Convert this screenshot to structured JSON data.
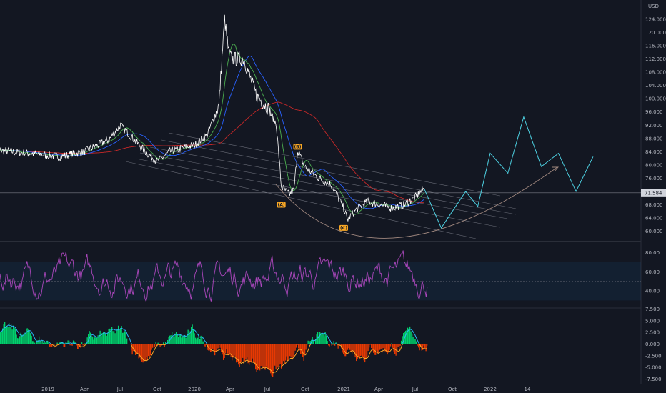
{
  "currency": "USD",
  "chart_data": [
    {
      "type": "line",
      "panel": "price",
      "y_ticks": [
        60,
        64,
        68,
        72,
        76,
        80,
        84,
        88,
        92,
        96,
        100,
        104,
        108,
        112,
        116,
        120,
        124
      ],
      "y_tick_labels": [
        "60.000",
        "64.000",
        "68.000",
        "72.000",
        "76.000",
        "80.000",
        "84.000",
        "88.000",
        "92.000",
        "96.000",
        "100.000",
        "104.000",
        "108.000",
        "112.000",
        "116.000",
        "120.000",
        "124.000"
      ],
      "ylim": [
        57.5,
        127.5
      ],
      "current_price_label": "71.584",
      "current_price": 71.58,
      "x_ticks": [
        "2019",
        "Apr",
        "Jul",
        "Oct",
        "2020",
        "Apr",
        "Jul",
        "Oct",
        "2021",
        "Apr",
        "Jul",
        "Oct",
        "2022",
        "14"
      ],
      "series": [
        {
          "color": "#ffffff",
          "role": "price",
          "x": [
            "2018-10",
            "2018-12",
            "2019-02",
            "2019-04",
            "2019-06",
            "2019-07",
            "2019-08",
            "2019-09",
            "2019-10",
            "2019-11",
            "2019-12",
            "2020-01",
            "2020-02",
            "2020-03",
            "2020-03-15",
            "2020-03-25",
            "2020-04",
            "2020-05",
            "2020-06",
            "2020-07",
            "2020-07-20",
            "2020-08",
            "2020-08-20",
            "2020-09",
            "2020-09-10",
            "2020-09-25",
            "2020-10",
            "2020-11",
            "2020-12",
            "2020-12-15",
            "2021-01",
            "2021-01-10",
            "2021-02",
            "2021-03",
            "2021-04",
            "2021-05",
            "2021-06",
            "2021-07",
            "2021-07-20"
          ],
          "y": [
            84.5,
            83.5,
            82.5,
            84.0,
            87.5,
            92.0,
            88.0,
            84.0,
            81.0,
            84.0,
            85.0,
            86.0,
            89.0,
            98.0,
            124.0,
            114.0,
            112.0,
            112.0,
            101.0,
            97.0,
            92.0,
            73.5,
            71.0,
            72.5,
            84.5,
            80.0,
            79.0,
            76.0,
            74.0,
            71.0,
            67.0,
            63.5,
            66.5,
            69.0,
            68.0,
            67.0,
            68.0,
            70.5,
            73.0
          ]
        },
        {
          "color": "#4caf50",
          "role": "ma-short",
          "values_from": "price"
        },
        {
          "color": "#2962ff",
          "role": "ma-medium",
          "values_from": "price"
        },
        {
          "color": "#c62828",
          "role": "ma-long",
          "values_from": "price"
        }
      ],
      "wave_labels": [
        {
          "text": "(A)",
          "x": "2020-08",
          "y": 68.0
        },
        {
          "text": "(B)",
          "x": "2020-09-10",
          "y": 85.5
        },
        {
          "text": "(C)",
          "x": "2021-01",
          "y": 61.0
        }
      ],
      "projection": {
        "color": "#4dd0e1",
        "x": [
          "2021-07-20",
          "2021-09",
          "2021-11",
          "2021-12",
          "2022-01",
          "2022-02",
          "2022-03",
          "2022-04",
          "2022-05",
          "2022-06",
          "2022-07"
        ],
        "y": [
          73.0,
          61.0,
          72.0,
          67.5,
          83.5,
          77.5,
          94.5,
          79.5,
          83.5,
          72.0,
          82.5
        ]
      },
      "arc": {
        "color": "#a1887f"
      }
    },
    {
      "type": "line",
      "panel": "oscillator",
      "y_ticks": [
        40,
        60,
        80
      ],
      "y_tick_labels": [
        "40.00",
        "60.00",
        "80.00"
      ],
      "ylim": [
        28,
        92
      ],
      "band": [
        30,
        70
      ],
      "midline": 50,
      "series": [
        {
          "color": "#ab47bc",
          "role": "rsi"
        }
      ]
    },
    {
      "type": "bar",
      "panel": "momentum",
      "y_ticks": [
        -7.5,
        -5.0,
        -2.5,
        0,
        2.5,
        5.0,
        7.5
      ],
      "y_tick_labels": [
        "-7.500",
        "-5.000",
        "-2.500",
        "0.000",
        "2.500",
        "5.000",
        "7.500"
      ],
      "ylim": [
        -8.5,
        8.5
      ],
      "series": [
        {
          "color": "#00e676",
          "role": "positive-histogram"
        },
        {
          "color": "#ff3d00",
          "role": "negative-histogram"
        },
        {
          "color": "#29b6f6",
          "role": "signal-positive"
        },
        {
          "color": "#ffa726",
          "role": "signal-negative"
        }
      ]
    }
  ]
}
